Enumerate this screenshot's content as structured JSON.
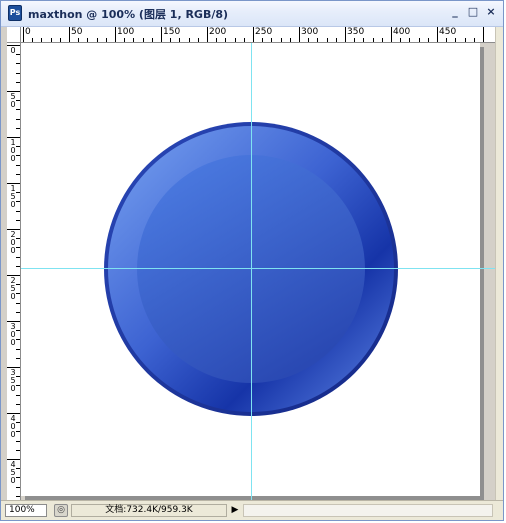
{
  "window": {
    "title": "maxthon @ 100% (图层 1, RGB/8)",
    "app_icon": "photoshop-document-icon",
    "app_icon_text": "Ps",
    "buttons": {
      "minimize": "_",
      "maximize": "□",
      "close": "×"
    }
  },
  "rulers": {
    "horizontal_labels": [
      "0",
      "50",
      "100",
      "150",
      "200",
      "250",
      "300",
      "350",
      "400",
      "450"
    ],
    "vertical_labels": [
      "0",
      "50",
      "100",
      "150",
      "200",
      "250",
      "300",
      "350",
      "400",
      "450"
    ]
  },
  "canvas": {
    "background": "#ffffff",
    "guide_color": "#7fe3f1",
    "graphic": {
      "description_name": "blue-round-button",
      "colors": {
        "outer_ring": "#1b2f8c",
        "bezel_light": "#6f97ec",
        "bezel_dark": "#1330a3",
        "inner_top": "#4a7ae0",
        "inner_bottom": "#2b4bb5"
      }
    }
  },
  "statusbar": {
    "zoom": "100%",
    "nav_icon": "navigator-icon",
    "doc_info": "文档:732.4K/959.3K",
    "menu_arrow": "▶"
  }
}
